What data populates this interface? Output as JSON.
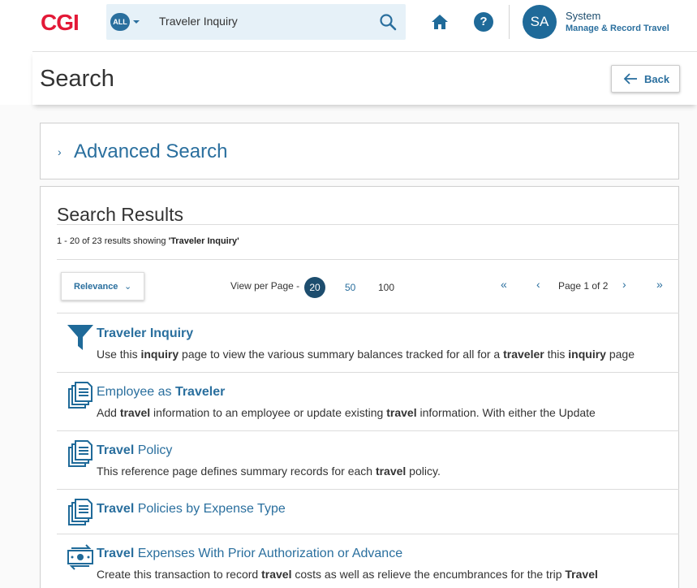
{
  "brand": {
    "logo": "CGI"
  },
  "search": {
    "scope": "ALL",
    "query": "Traveler Inquiry"
  },
  "user": {
    "initials": "SA",
    "name": "System",
    "role": "Manage & Record Travel"
  },
  "page": {
    "title": "Search",
    "back_label": "Back"
  },
  "advanced_search": {
    "title": "Advanced Search"
  },
  "results": {
    "title": "Search Results",
    "summary_prefix": "1 - 20 of 23 results showing ",
    "summary_query": "'Traveler Inquiry'",
    "sort_label": "Relevance",
    "view_per_page_label": "View per Page -",
    "page_sizes": [
      "20",
      "50",
      "100"
    ],
    "selected_page_size": "20",
    "page_label": "Page 1 of 2",
    "items": [
      {
        "icon": "filter-funnel-icon",
        "title_parts": [
          {
            "t": "Traveler Inquiry",
            "b": true
          }
        ],
        "desc_parts": [
          {
            "t": "Use this ",
            "b": false
          },
          {
            "t": "inquiry",
            "b": true
          },
          {
            "t": " page to view the various summary balances tracked for all for a ",
            "b": false
          },
          {
            "t": "traveler",
            "b": true
          },
          {
            "t": " this ",
            "b": false
          },
          {
            "t": "inquiry",
            "b": true
          },
          {
            "t": " page",
            "b": false
          }
        ]
      },
      {
        "icon": "document-stack-icon",
        "title_parts": [
          {
            "t": "Employee as ",
            "b": false
          },
          {
            "t": "Traveler",
            "b": true
          }
        ],
        "desc_parts": [
          {
            "t": "Add ",
            "b": false
          },
          {
            "t": "travel",
            "b": true
          },
          {
            "t": " information to an employee or update existing ",
            "b": false
          },
          {
            "t": "travel",
            "b": true
          },
          {
            "t": " information. With either the Update",
            "b": false
          }
        ]
      },
      {
        "icon": "document-stack-icon",
        "title_parts": [
          {
            "t": "Travel",
            "b": true
          },
          {
            "t": " Policy",
            "b": false
          }
        ],
        "desc_parts": [
          {
            "t": "This reference page defines summary records for each ",
            "b": false
          },
          {
            "t": "travel",
            "b": true
          },
          {
            "t": " policy.",
            "b": false
          }
        ]
      },
      {
        "icon": "document-stack-icon",
        "title_parts": [
          {
            "t": "Travel",
            "b": true
          },
          {
            "t": " Policies by Expense Type",
            "b": false
          }
        ],
        "desc_parts": []
      },
      {
        "icon": "money-transfer-icon",
        "title_parts": [
          {
            "t": "Travel",
            "b": true
          },
          {
            "t": " Expenses With Prior Authorization or Advance",
            "b": false
          }
        ],
        "desc_parts": [
          {
            "t": "Create this transaction to record ",
            "b": false
          },
          {
            "t": "travel",
            "b": true
          },
          {
            "t": " costs as well as relieve the encumbrances for the trip ",
            "b": false
          },
          {
            "t": "Travel",
            "b": true
          }
        ]
      }
    ]
  },
  "colors": {
    "brand_red": "#e31937",
    "accent_blue": "#2a6f9e",
    "dark_blue": "#1d4d6e"
  }
}
